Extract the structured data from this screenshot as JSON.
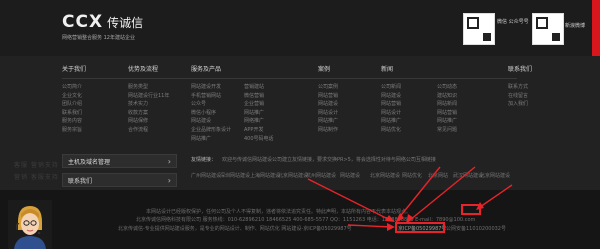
{
  "brand": {
    "logo_text": "CCX",
    "logo_cn": "传诚信",
    "tagline": "网络营销整合服务 12年建站企业"
  },
  "qr": [
    {
      "label": "微信\n公众号号"
    },
    {
      "label": "新浪微博"
    }
  ],
  "nav_columns": [
    {
      "title": "关于我们",
      "items": [
        "公司简介",
        "企业文化",
        "团队介绍",
        "联系我们",
        "服务内容",
        "服务宗旨"
      ]
    },
    {
      "title": "优势及流程",
      "items": [
        "服务类型",
        "网站建设行业11年",
        "技术实力",
        "收款方案",
        "网站保修",
        "合作流程"
      ]
    },
    {
      "title": "服务及产品",
      "items": [
        "网站建设开发",
        "手机营销网站",
        "公众号",
        "微信小程序",
        "网站建设",
        "企业品牌形象设计",
        "网站推广"
      ]
    },
    {
      "title": "",
      "items": [
        "营销建站",
        "微信营销",
        "企业营销",
        "网站推广",
        "网络推广",
        "APP开发",
        "400号码电话"
      ]
    },
    {
      "title": "案例",
      "items": [
        "公司案例",
        "网站营销",
        "网站建设",
        "网站设计",
        "网站推广",
        "网站制作"
      ]
    },
    {
      "title": "新闻",
      "items": [
        "公司新闻",
        "网站建设",
        "网站营销",
        "网站设计",
        "网站推广",
        "网站优化"
      ]
    },
    {
      "title": "",
      "items": [
        "公司动态",
        "建站知识",
        "网站新闻",
        "网站营销",
        "网站推广",
        "常见问题"
      ]
    },
    {
      "title": "联系我们",
      "items": [
        "联系方式",
        "在线留言",
        "加入我们"
      ]
    }
  ],
  "left_buttons": [
    {
      "label": "主机及域名管理",
      "arrow": "›"
    },
    {
      "label": "联系我们",
      "arrow": "›"
    }
  ],
  "friend_links": {
    "title": "友情链接：",
    "text": "欢迎与传诚信网站建设公司建立友情链接，要求交换PR>5，将会选择性对待与网络公司互相链接",
    "links": [
      "广州网站建设",
      "深圳网站建设",
      "上海网站建设",
      "北京网站建设",
      "杭州网站建设",
      "网站建设",
      "北京网站建设",
      "网站优化",
      "北京网站",
      "武汉网站建设",
      "北京网站建设"
    ]
  },
  "footer": {
    "line1": "本网站设计已经版权保护，任何公司及个人不得复制，违者将依法追究责任。特此声明，本站所有内容不代表本站观点。",
    "line2": "北京传诚信网络科技有限公司 服务热线：010-62896210 18466525 400-685-5577 QQ：1151263 电话：1848888889 E-mail：7890@100.com",
    "line3": "北京传诚信-专业提供网站建设服务，是专业的网站设计、制作、网站优化 网站建设-京ICP备05029987号",
    "icp": "京ICP备05029987号",
    "police": "公网安备11010200032号"
  },
  "sidetext": [
    "客服 营销支持",
    "营销 客服支持"
  ],
  "colors": {
    "accent_red": "#e8232a",
    "bg": "#1f1f1f"
  }
}
